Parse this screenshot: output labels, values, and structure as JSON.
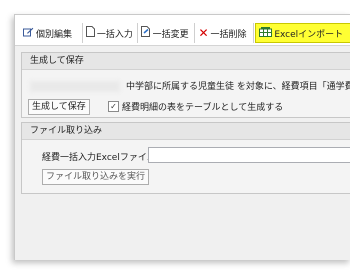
{
  "toolbar": {
    "items": [
      {
        "label": "個別編集",
        "icon": "pencil-icon"
      },
      {
        "label": "一括入力",
        "icon": "document-icon"
      },
      {
        "label": "一括変更",
        "icon": "document-edit-icon"
      },
      {
        "label": "一括削除",
        "icon": "close-icon"
      },
      {
        "label": "Excelインポート",
        "icon": "excel-import-icon",
        "active": true
      }
    ]
  },
  "generate_section": {
    "title": "生成して保存",
    "description": "中学部に所属する児童生徒 を対象に、経費項目「通学費",
    "generate_button": "生成して保存",
    "checkbox_label": "経費明細の表をテーブルとして生成する",
    "checkbox_checked": true
  },
  "import_section": {
    "title": "ファイル取り込み",
    "file_label": "経費一括入力Excelファイル",
    "file_value": "",
    "import_button": "ファイル取り込みを実行"
  },
  "colors": {
    "active_tab": "#ffff33",
    "delete_icon": "#d40000"
  }
}
